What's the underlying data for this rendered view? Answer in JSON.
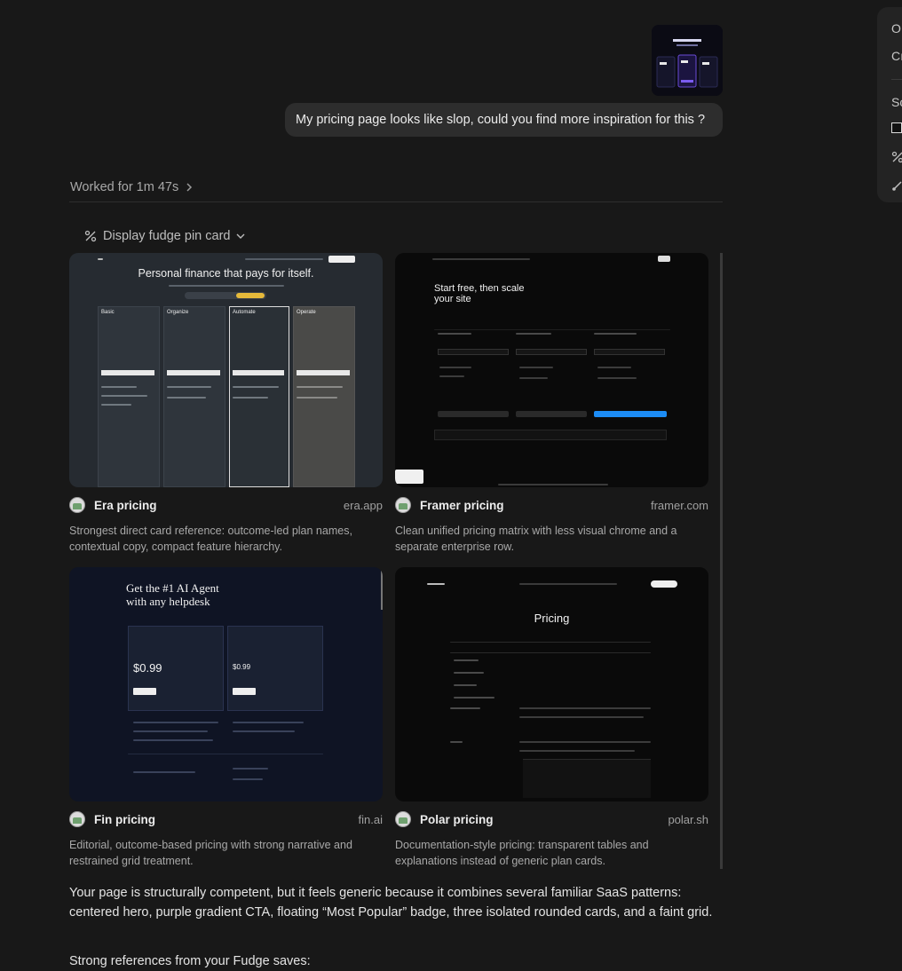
{
  "user_message": {
    "text": "My pricing page looks like slop, could you find more inspiration for this ?"
  },
  "worked": {
    "label": "Worked for 1m 47s"
  },
  "tool_call": {
    "label": "Display fudge pin card"
  },
  "cards": [
    {
      "title": "Era pricing",
      "domain": "era.app",
      "description": "Strongest direct card reference: outcome-led plan names, contextual copy, compact feature hierarchy.",
      "headline": "Personal finance that pays for itself.",
      "plans": [
        "Basic",
        "Organize",
        "Automate",
        "Operate"
      ]
    },
    {
      "title": "Framer pricing",
      "domain": "framer.com",
      "description": "Clean unified pricing matrix with less visual chrome and a separate enterprise row.",
      "headline": "Start free, then scale your site"
    },
    {
      "title": "Fin pricing",
      "domain": "fin.ai",
      "description": "Editorial, outcome-based pricing with strong narrative and restrained grid treatment.",
      "headline": "Get the #1 AI Agent with any helpdesk",
      "prices": [
        "$0.99",
        "$0.99"
      ]
    },
    {
      "title": "Polar pricing",
      "domain": "polar.sh",
      "description": "Documentation-style pricing: transparent tables and explanations instead of generic plan cards.",
      "headline": "Pricing"
    }
  ],
  "response": {
    "paragraph1": "Your page is structurally competent, but it feels generic because it combines several familiar SaaS patterns: centered hero, purple gradient CTA, floating “Most Popular” badge, three isolated rounded cards, and a faint grid.",
    "paragraph2": "Strong references from your Fudge saves:"
  },
  "side_panel": {
    "items": [
      "O",
      "Cı",
      "Sc"
    ]
  }
}
